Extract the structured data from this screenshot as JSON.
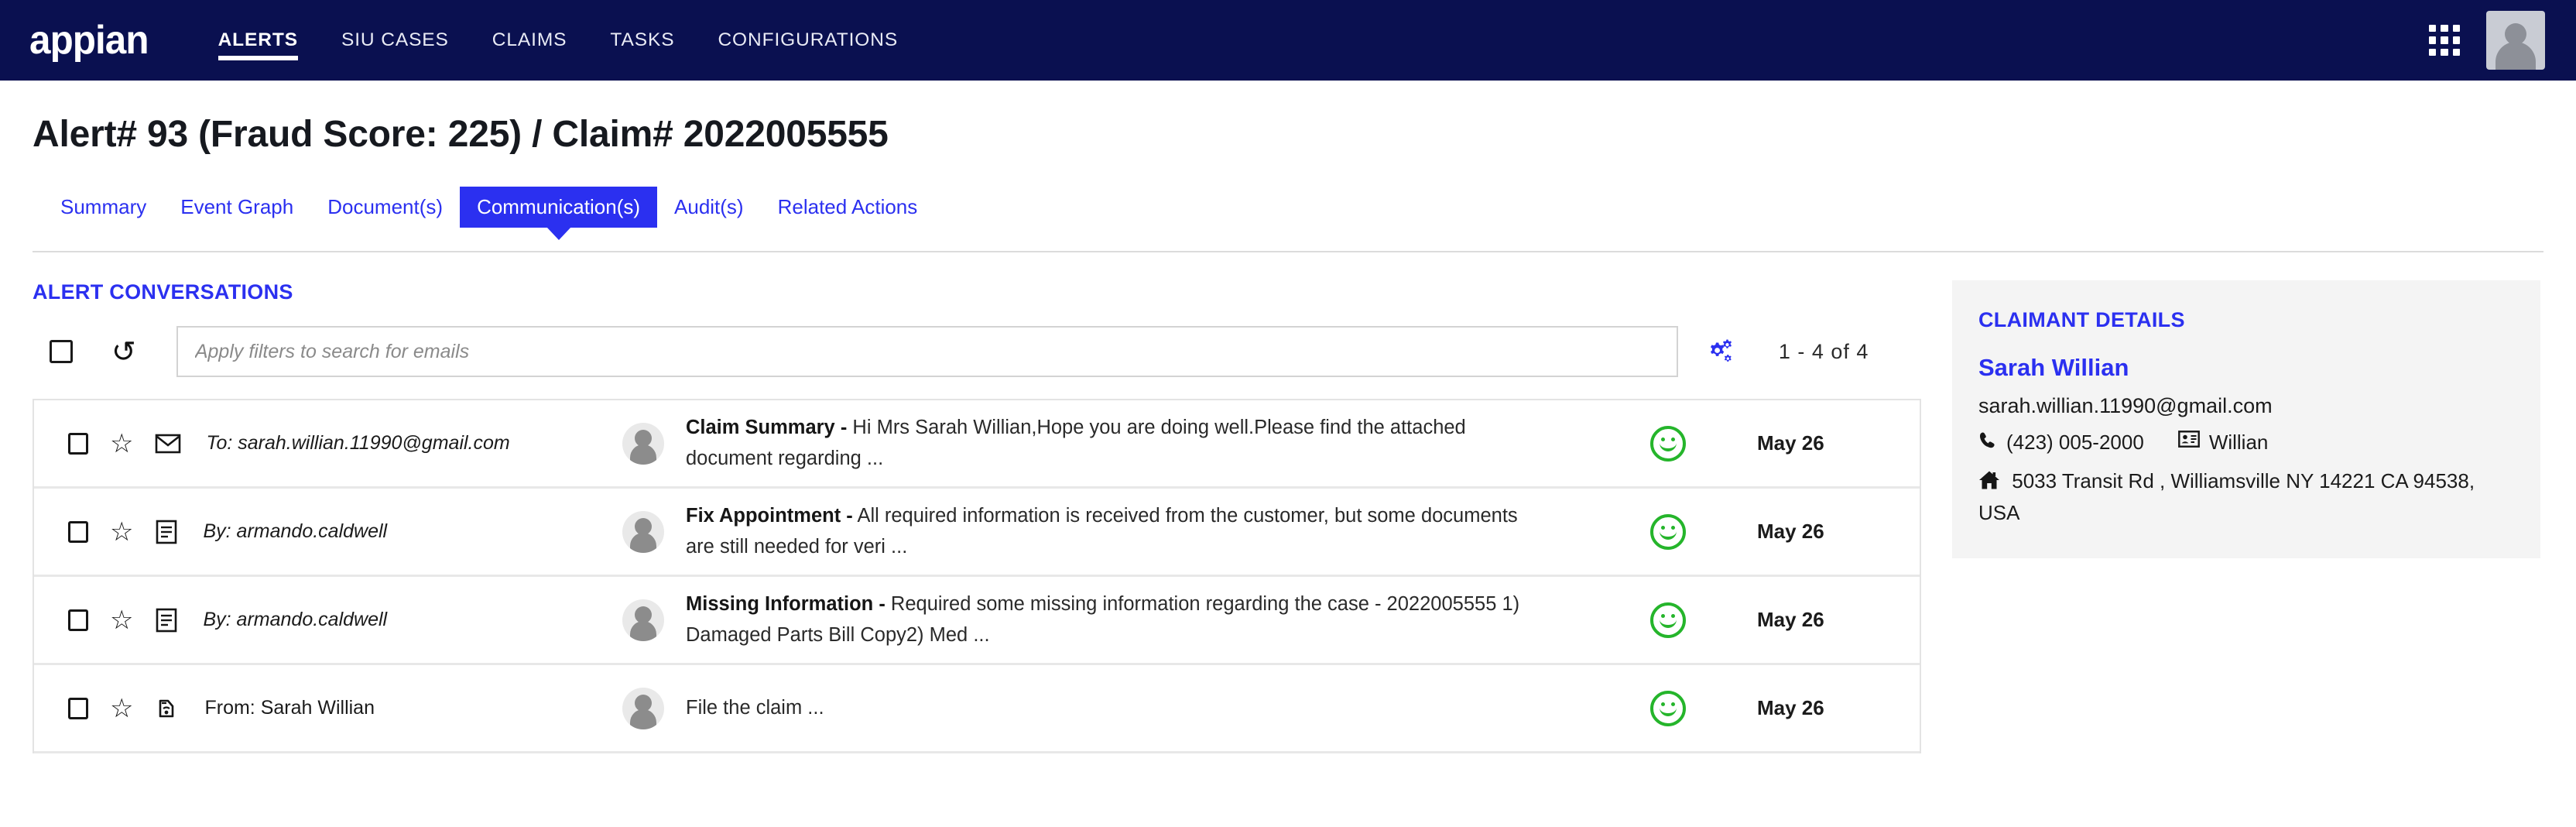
{
  "topnav": {
    "brand": "appian",
    "links": [
      {
        "label": "ALERTS",
        "active": true
      },
      {
        "label": "SIU CASES",
        "active": false
      },
      {
        "label": "CLAIMS",
        "active": false
      },
      {
        "label": "TASKS",
        "active": false
      },
      {
        "label": "CONFIGURATIONS",
        "active": false
      }
    ],
    "apps_icon": "grid-apps-icon",
    "avatar": "user-avatar"
  },
  "page": {
    "title": "Alert# 93 (Fraud Score: 225) / Claim# 2022005555"
  },
  "tabs": [
    {
      "label": "Summary",
      "active": false
    },
    {
      "label": "Event Graph",
      "active": false
    },
    {
      "label": "Document(s)",
      "active": false
    },
    {
      "label": "Communication(s)",
      "active": true
    },
    {
      "label": "Audit(s)",
      "active": false
    },
    {
      "label": "Related Actions",
      "active": false
    }
  ],
  "conversations": {
    "heading": "ALERT CONVERSATIONS",
    "toolbar": {
      "select_all": "",
      "refresh_icon": "refresh-icon",
      "search_placeholder": "Apply filters to search for emails",
      "search_value": "",
      "settings_icon": "gears-settings-icon",
      "pagination": "1 - 4  of  4"
    },
    "rows": [
      {
        "sender": "To: sarah.willian.11990@gmail.com",
        "sender_italic": true,
        "type_icon": "envelope-icon",
        "subject": "Claim Summary -",
        "preview": " Hi Mrs Sarah Willian,Hope you are doing well.Please find the attached document regarding ...",
        "sentiment": "positive-smiley",
        "date": "May 26"
      },
      {
        "sender": "By: armando.caldwell",
        "sender_italic": true,
        "type_icon": "note-document-icon",
        "subject": "Fix Appointment -",
        "preview": " All required information is received from the customer, but some documents are still needed for veri ...",
        "sentiment": "positive-smiley",
        "date": "May 26"
      },
      {
        "sender": "By: armando.caldwell",
        "sender_italic": true,
        "type_icon": "note-document-icon",
        "subject": "Missing Information -",
        "preview": " Required some missing information regarding the case - 2022005555 1) Damaged Parts Bill Copy2) Med ...",
        "sentiment": "positive-smiley",
        "date": "May 26"
      },
      {
        "sender": "From: Sarah Willian",
        "sender_italic": false,
        "type_icon": "phone-call-icon",
        "subject": "",
        "preview": "File the claim ...",
        "sentiment": "positive-smiley",
        "date": "May 26"
      }
    ]
  },
  "claimant": {
    "heading": "CLAIMANT DETAILS",
    "name": "Sarah Willian",
    "email": "sarah.willian.11990@gmail.com",
    "phone_icon": "phone-icon",
    "phone": "(423) 005-2000",
    "id_icon": "id-card-icon",
    "last_name": "Willian",
    "home_icon": "home-icon",
    "address": "5033 Transit Rd   , Williamsville NY 14221 CA 94538, USA"
  },
  "colors": {
    "nav_bg": "#0a1050",
    "accent": "#2b30f0",
    "sentiment_green": "#25b52b"
  }
}
